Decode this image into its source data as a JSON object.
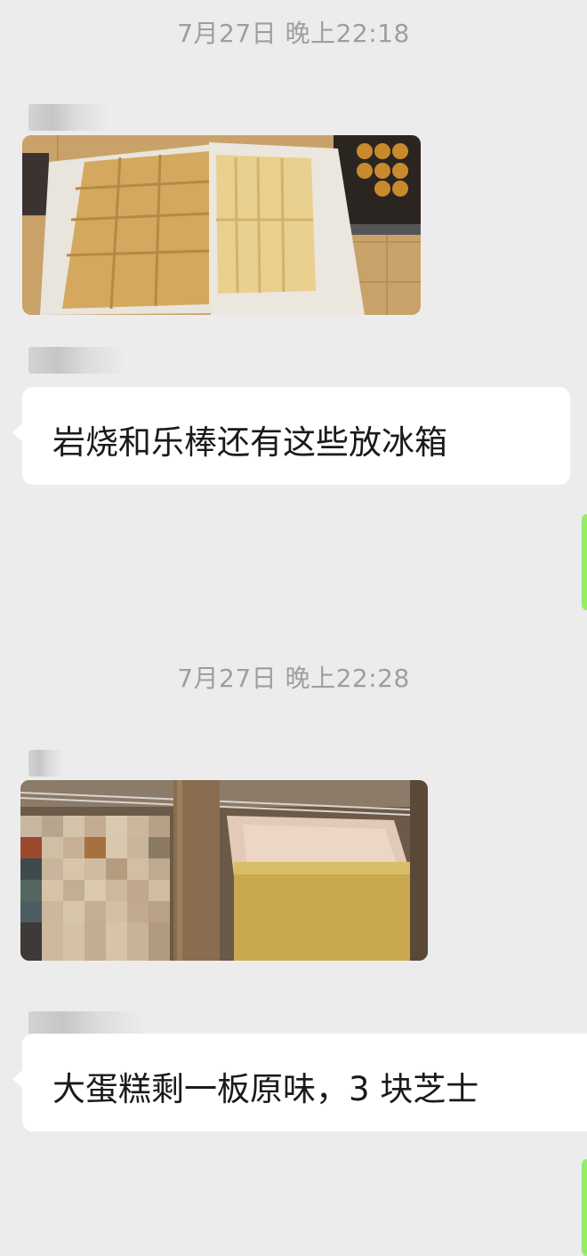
{
  "chat": {
    "messages": [
      {
        "type": "timestamp",
        "text": "7月27日 晚上22:18"
      },
      {
        "type": "image",
        "alt": "baked cookie bars on trays"
      },
      {
        "type": "text",
        "text": "岩烧和乐棒还有这些放冰箱"
      },
      {
        "type": "timestamp",
        "text": "7月27日 晚上22:28"
      },
      {
        "type": "image",
        "alt": "cake boxes stored on a shelf"
      },
      {
        "type": "text",
        "text": "大蛋糕剩一板原味，3 块芝士"
      }
    ]
  },
  "colors": {
    "background": "#ececec",
    "incoming_bubble": "#ffffff",
    "outgoing_bubble": "#95ec69",
    "timestamp_text": "#9e9e9e",
    "message_text": "#1a1a1a"
  }
}
